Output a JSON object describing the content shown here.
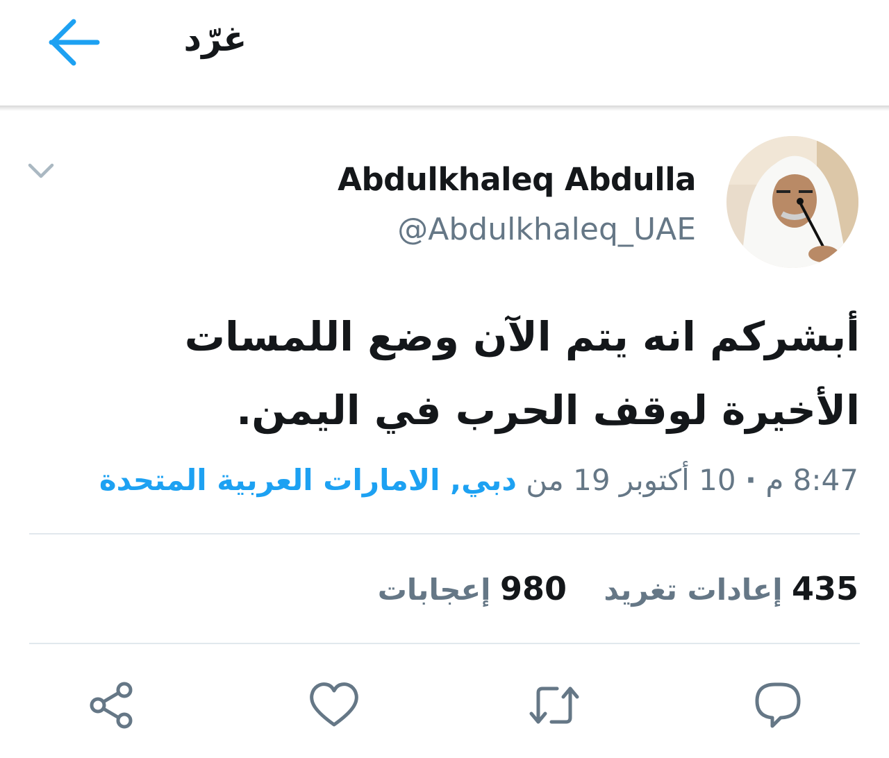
{
  "header": {
    "title": "غرّد"
  },
  "tweet": {
    "author_name": "Abdulkhaleq Abdulla",
    "author_handle": "@Abdulkhaleq_UAE",
    "text_line1": "أبشركم انه يتم الآن وضع اللمسات",
    "text_line2": "الأخيرة لوقف الحرب في اليمن.",
    "time": "8:47 م",
    "dot": "·",
    "date": "10 أكتوبر 19",
    "from": "من",
    "location": "دبي, الامارات العربية المتحدة"
  },
  "stats": {
    "retweets_count": "435",
    "retweets_label": "إعادات تغريد",
    "likes_count": "980",
    "likes_label": "إعجابات"
  },
  "colors": {
    "accent": "#1da1f2",
    "secondary_text": "#657786",
    "icon": "#657786",
    "divider": "#e1e8ed"
  },
  "icons": {
    "back": "arrow-left-icon",
    "caret": "chevron-down-icon",
    "share": "share-icon",
    "like": "heart-icon",
    "retweet": "retweet-icon",
    "reply": "reply-icon"
  }
}
